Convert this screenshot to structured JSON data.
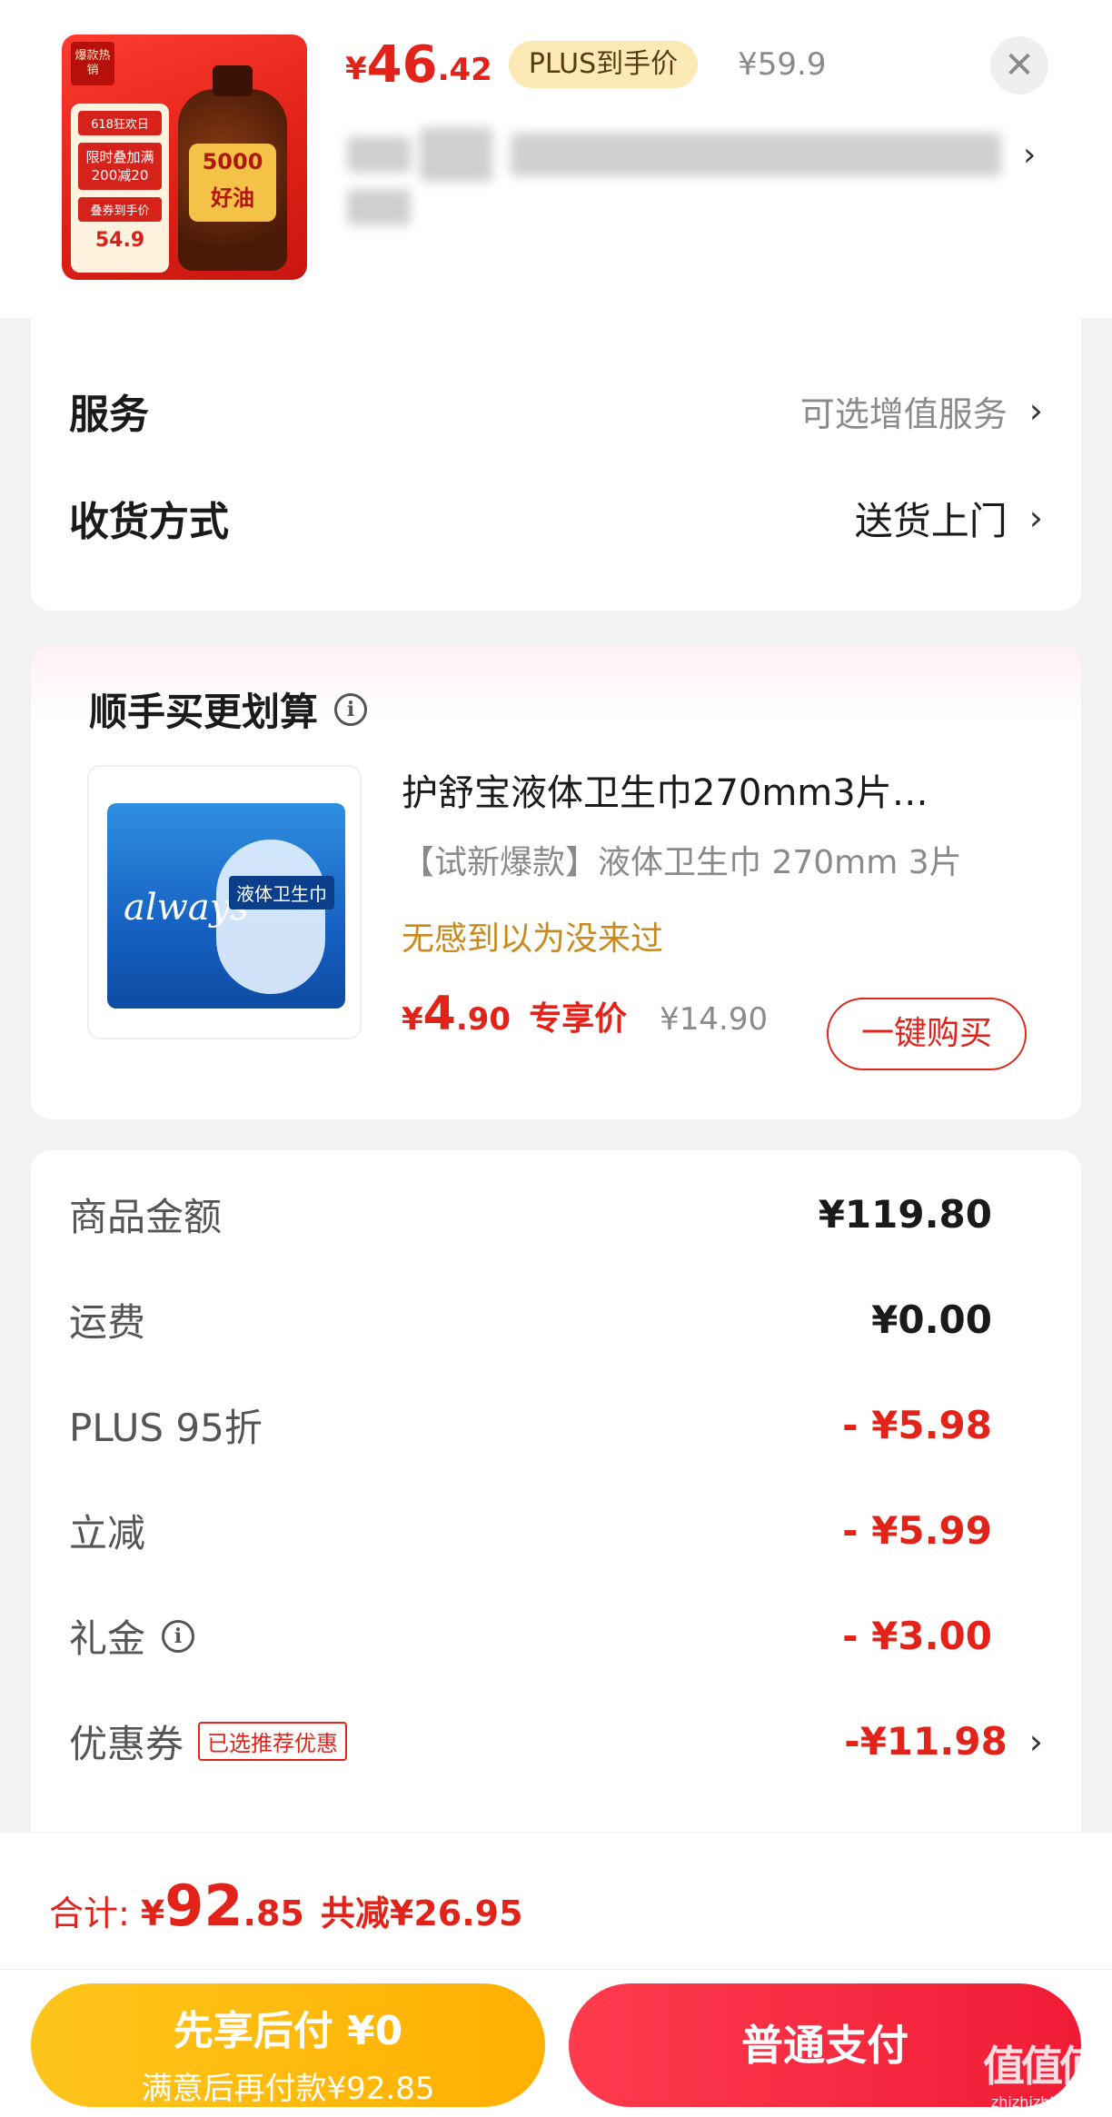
{
  "header": {
    "thumb": {
      "corner": "爆款热销",
      "badge1": "618狂欢日",
      "badge2": "限时叠加满200减20",
      "badge3": "叠券到手价",
      "badge_price": "54.9",
      "bottle_text": "5000 好油"
    },
    "price_yen": "¥",
    "price_int": "46",
    "price_dec": ".42",
    "plus_label": "PLUS到手价",
    "orig_price": "¥59.9",
    "close_icon": "close-icon"
  },
  "options": {
    "service_label": "服务",
    "service_value": "可选增值服务",
    "delivery_label": "收货方式",
    "delivery_value": "送货上门"
  },
  "recommend": {
    "title": "顺手买更划算",
    "name": "护舒宝液体卫生巾270mm3片…",
    "desc": "【试新爆款】液体卫生巾 270mm 3片",
    "slogan": "无感到以为没来过",
    "price_yen": "¥",
    "price_int": "4",
    "price_dec": ".90",
    "price_tag": "专享价",
    "orig_price": "¥14.90",
    "buy_label": "一键购买",
    "pkg_logo": "always",
    "pkg_tag": "液体卫生巾"
  },
  "summary": {
    "rows": [
      {
        "label": "商品金额",
        "value": "¥119.80"
      },
      {
        "label": "运费",
        "value": "¥0.00"
      },
      {
        "label": "PLUS 95折",
        "value": "- ¥5.98"
      },
      {
        "label": "立减",
        "value": "- ¥5.99"
      },
      {
        "label": "礼金",
        "value": "- ¥3.00"
      },
      {
        "label": "优惠券",
        "value": "-¥11.98",
        "badge": "已选推荐优惠"
      }
    ]
  },
  "footer": {
    "total_label": "合计:",
    "total_yen": "¥",
    "total_int": "92",
    "total_dec": ".85",
    "saved": "共减¥26.95",
    "pay_later_title": "先享后付 ¥0",
    "pay_later_sub": "满意后再付款¥92.85",
    "pay_normal": "普通支付"
  },
  "watermark": {
    "line1": "值值值",
    "line2": "zhizhizhi.com"
  },
  "colors": {
    "accent": "#e2231a",
    "gold": "#c98a1d",
    "plus_badge": "#fbe9b6",
    "pay_later": "#ffb000",
    "pay_normal": "#f01c36"
  }
}
